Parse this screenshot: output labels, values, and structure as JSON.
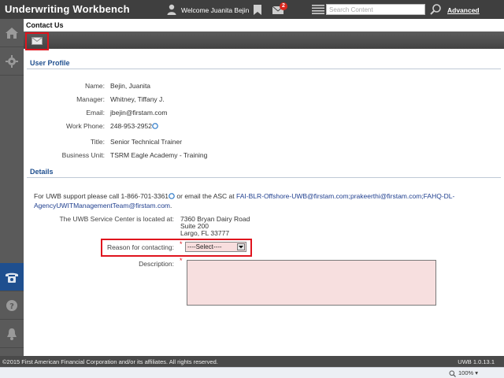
{
  "header": {
    "app_title": "Underwriting Workbench",
    "welcome": "Welcome Juanita Bejin",
    "mail_count": "2",
    "search_placeholder": "Search Content",
    "advanced_label": "Advanced"
  },
  "page": {
    "title": "Contact Us"
  },
  "profile": {
    "heading": "User Profile",
    "fields": [
      {
        "label": "Name:",
        "value": "Bejin, Juanita"
      },
      {
        "label": "Manager:",
        "value": "Whitney, Tiffany J."
      },
      {
        "label": "Email:",
        "value": "jbejin@firstam.com"
      },
      {
        "label": "Work Phone:",
        "value": "248-953-2952"
      },
      {
        "label": "Title:",
        "value": "Senior Technical Trainer"
      },
      {
        "label": "Business Unit:",
        "value": "TSRM Eagle Academy - Training"
      }
    ]
  },
  "details": {
    "heading": "Details",
    "support_prefix": "For UWB support please call 1-866-701-3361",
    "support_mid": " or email the ASC at ",
    "support_emails": "FAI-BLR-Offshore-UWB@firstam.com;prakeerthi@firstam.com;FAHQ-DL-AgencyUWITManagementTeam@firstam.com",
    "support_suffix": ".",
    "service_center_label": "The UWB Service Center is located at:",
    "address_line1": "7360 Bryan Dairy Road",
    "address_line2": "Suite 200",
    "address_line3": "Largo, FL 33777",
    "reason_label": "Reason for contacting:",
    "reason_selected": "----Select----",
    "description_label": "Description:",
    "required_mark": "*"
  },
  "footer": {
    "copyright": "©2015 First American Financial Corporation and/or its affiliates. All rights reserved.",
    "version": "UWB 1.0.13.1",
    "zoom": "100%"
  },
  "colors": {
    "accent": "#1f4f8f",
    "highlight": "#e0141e",
    "required_bg": "#f7dfdf"
  }
}
